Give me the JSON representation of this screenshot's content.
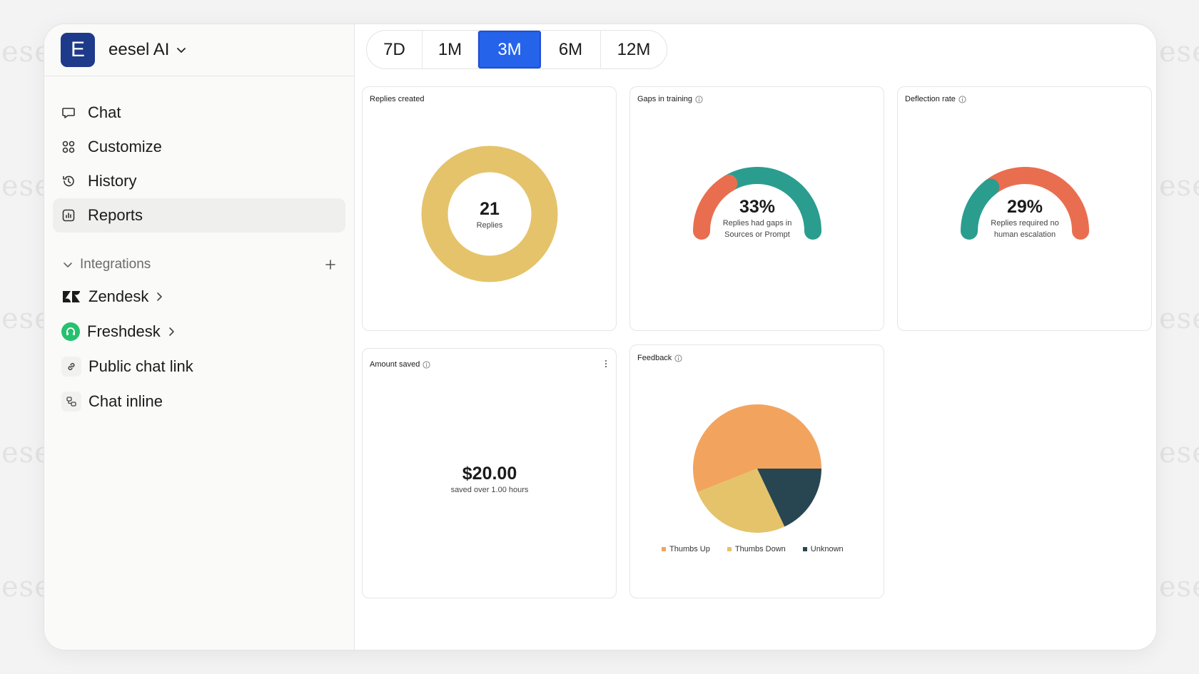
{
  "watermark": "ese",
  "workspace": {
    "initial": "E",
    "name": "eesel AI"
  },
  "nav": [
    {
      "label": "Chat",
      "icon": "chat-bubble-icon"
    },
    {
      "label": "Customize",
      "icon": "customize-icon"
    },
    {
      "label": "History",
      "icon": "history-icon"
    },
    {
      "label": "Reports",
      "icon": "reports-icon",
      "active": true
    }
  ],
  "integrations": {
    "heading": "Integrations",
    "items": [
      {
        "label": "Zendesk",
        "icon": "zendesk-icon",
        "has_arrow": true
      },
      {
        "label": "Freshdesk",
        "icon": "freshdesk-icon",
        "has_arrow": true
      },
      {
        "label": "Public chat link",
        "icon": "link-icon",
        "has_arrow": false
      },
      {
        "label": "Chat inline",
        "icon": "chat-inline-icon",
        "has_arrow": false
      }
    ]
  },
  "ranges": {
    "options": [
      "7D",
      "1M",
      "3M",
      "6M",
      "12M"
    ],
    "selected": "3M"
  },
  "cards": {
    "replies": {
      "title": "Replies created",
      "value": "21",
      "caption": "Replies",
      "color": "#e5c36a"
    },
    "gaps": {
      "title": "Gaps in training",
      "value": "33%",
      "caption_line1": "Replies had gaps in",
      "caption_line2": "Sources or Prompt",
      "fraction": 0.33,
      "fill_color": "#e96e4f",
      "rest_color": "#2a9d8f"
    },
    "deflection": {
      "title": "Deflection rate",
      "value": "29%",
      "caption_line1": "Replies required no",
      "caption_line2": "human escalation",
      "fraction": 0.29,
      "fill_color": "#2a9d8f",
      "rest_color": "#e96e4f"
    },
    "amount": {
      "title": "Amount saved",
      "value": "$20.00",
      "caption": "saved over 1.00 hours"
    },
    "feedback": {
      "title": "Feedback"
    }
  },
  "chart_data": {
    "type": "pie",
    "categories": [
      "Thumbs Up",
      "Thumbs Down",
      "Unknown"
    ],
    "values": [
      56,
      26,
      18
    ],
    "colors": [
      "#f2a45f",
      "#e5c36a",
      "#284652"
    ]
  }
}
